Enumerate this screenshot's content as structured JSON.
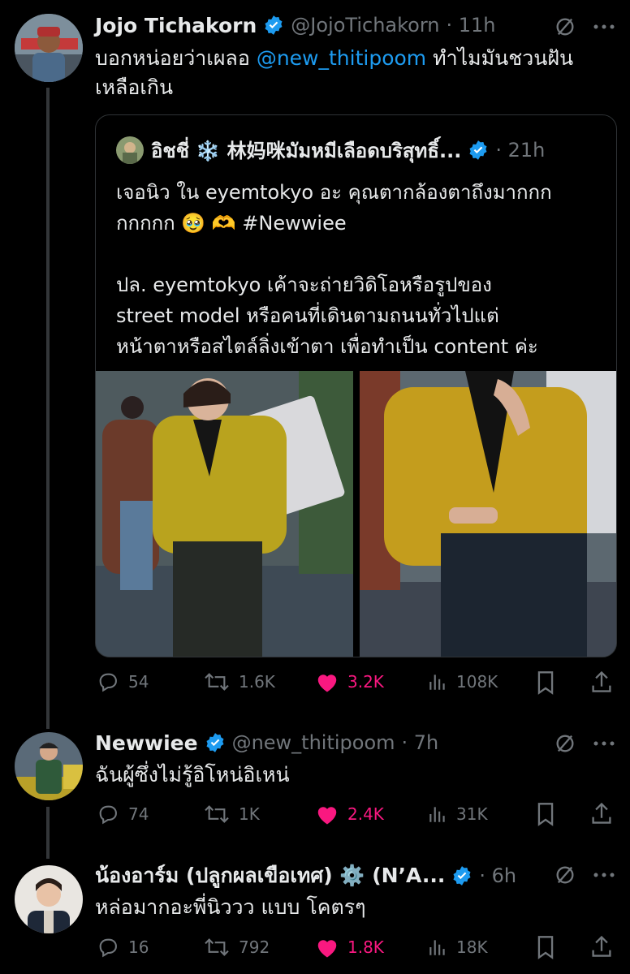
{
  "tweets": [
    {
      "name": "Jojo Tichakorn",
      "handle": "@JojoTichakorn",
      "time": "· 11h",
      "text_pre": "บอกหน่อยว่าเผลอ ",
      "mention": "@new_thitipoom",
      "text_post": " ทำไมมันชวนฝัน",
      "text_line2": "เหลือเกิน",
      "stats": {
        "replies": "54",
        "retweets": "1.6K",
        "likes": "3.2K",
        "views": "108K"
      }
    },
    {
      "name": "Newwiee",
      "handle": "@new_thitipoom",
      "time": "· 7h",
      "text": "ฉันผู้ซึ่งไม่รู้อิโหน่อิเหน่",
      "stats": {
        "replies": "74",
        "retweets": "1K",
        "likes": "2.4K",
        "views": "31K"
      }
    },
    {
      "name": "น้องอาร์ม (ปลูกผลเขือเทศ) ⚙️ (N’A...",
      "handle": "",
      "time": "· 6h",
      "text": "หล่อมากอะพี่นิววว แบบ โคตรๆ",
      "stats": {
        "replies": "16",
        "retweets": "792",
        "likes": "1.8K",
        "views": "18K"
      }
    }
  ],
  "quote": {
    "name": "อิชชี่ ❄️ 林妈咪มัมหมีเลือดบริสุทธิ์...",
    "time": "· 21h",
    "lines": [
      "เจอนิว ใน eyemtokyo อะ คุณตากล้องตาถึงมากกก",
      "กกกกก 🥹 🫶 #Newwiee",
      "",
      "ปล. eyemtokyo เค้าจะถ่ายวิดิโอหรือรูปของ",
      "street model หรือคนที่เดินตามถนนทั่วไปแต่",
      "หน้าตาหรือสไตล์ลิ่งเข้าตา เพื่อทำเป็น content ค่ะ"
    ]
  },
  "colors": {
    "background": "#000000",
    "text": "#e7e9ea",
    "secondary": "#71767b",
    "link": "#1d9bf0",
    "like": "#f91880",
    "verified": "#1d9bf0"
  },
  "icons": {
    "verified": "verified-badge-icon",
    "grok": "slashed-circle-icon",
    "more": "more-dots-icon",
    "reply": "reply-icon",
    "retweet": "retweet-icon",
    "like": "heart-icon",
    "views": "views-icon",
    "bookmark": "bookmark-icon",
    "share": "share-icon"
  }
}
